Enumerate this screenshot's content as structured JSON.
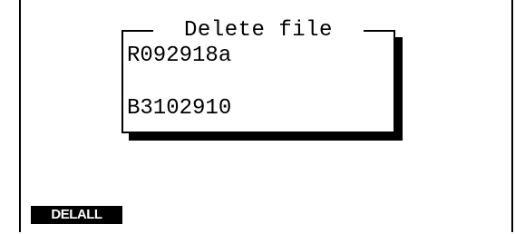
{
  "dialog": {
    "title": "Delete file",
    "files": [
      {
        "name": "R092918a"
      },
      {
        "name": "B3102910"
      }
    ]
  },
  "softkeys": [
    {
      "label": "DELALL"
    }
  ]
}
